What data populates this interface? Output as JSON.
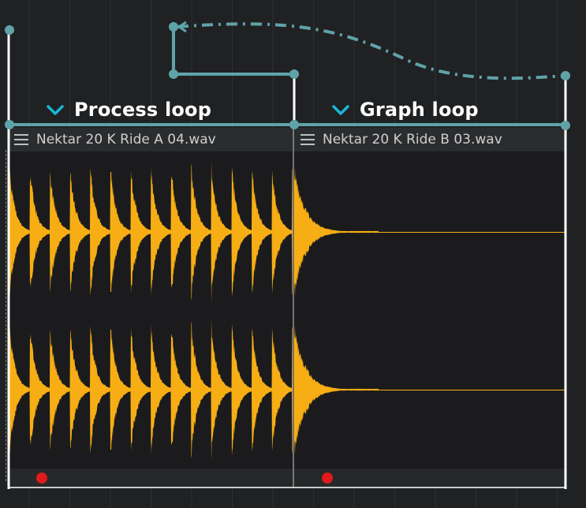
{
  "loops": [
    {
      "title": "Process loop",
      "collapse_icon": "chevron-down-icon"
    },
    {
      "title": "Graph loop",
      "collapse_icon": "chevron-down-icon"
    }
  ],
  "clips": [
    {
      "filename": "Nektar 20 K Ride A 04.wav",
      "menu_icon": "hamburger-menu-icon",
      "record_indicator": "red-dot"
    },
    {
      "filename": "Nektar 20 K Ride B 03.wav",
      "menu_icon": "hamburger-menu-icon",
      "record_indicator": "red-dot"
    }
  ],
  "colors": {
    "background": "#202123",
    "waveform": "#f7ae14",
    "routing_line": "#5fa3a8",
    "accent_chevron": "#19b7d6",
    "playhead_line": "#ffffff",
    "record_dot": "#e01b1b"
  }
}
